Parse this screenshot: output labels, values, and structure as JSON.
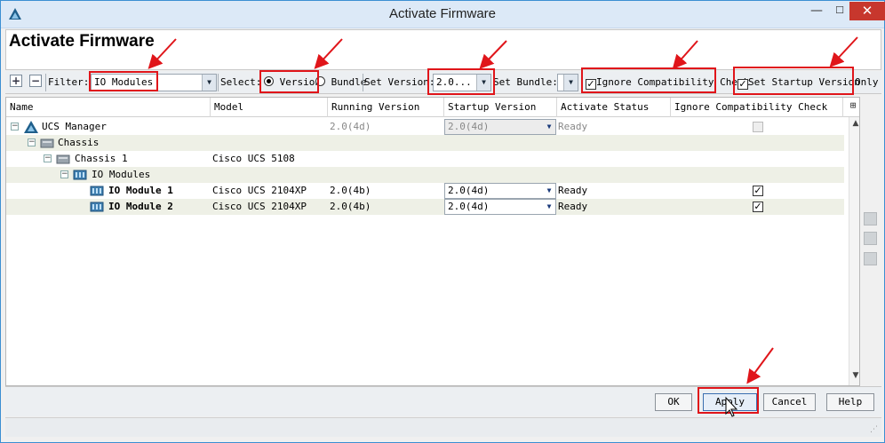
{
  "window": {
    "title": "Activate Firmware",
    "minimize": "—",
    "maximize": "☐",
    "close": "✕"
  },
  "header": {
    "title": "Activate Firmware"
  },
  "toolbar": {
    "expand": "+",
    "collapse": "−",
    "filter_label": "Filter:",
    "filter_value": "IO Modules",
    "select_label": "Select:",
    "version_radio": "Version",
    "bundle_radio": "Bundle",
    "set_version_label": "Set Version:",
    "set_version_value": "2.0...",
    "set_bundle_label": "Set Bundle:",
    "set_bundle_value": "",
    "ignore_check_label": "Ignore Compatibility Check",
    "startup_check_label": "Set Startup Version",
    "only_label": "Only"
  },
  "table": {
    "columns": [
      "Name",
      "Model",
      "Running Version",
      "Startup Version",
      "Activate Status",
      "Ignore Compatibility Check"
    ],
    "rows": [
      {
        "name": "UCS Manager",
        "model": "",
        "running": "2.0(4d)",
        "startup": "2.0(4d)",
        "status": "Ready",
        "ignore": false,
        "disabled": true
      },
      {
        "name": "Chassis",
        "model": "",
        "running": "",
        "startup": "",
        "status": "",
        "ignore": null
      },
      {
        "name": "Chassis 1",
        "model": "Cisco UCS 5108",
        "running": "",
        "startup": "",
        "status": "",
        "ignore": null
      },
      {
        "name": "IO Modules",
        "model": "",
        "running": "",
        "startup": "",
        "status": "",
        "ignore": null
      },
      {
        "name": "IO Module 1",
        "model": "Cisco UCS 2104XP",
        "running": "2.0(4b)",
        "startup": "2.0(4d)",
        "status": "Ready",
        "ignore": true
      },
      {
        "name": "IO Module 2",
        "model": "Cisco UCS 2104XP",
        "running": "2.0(4b)",
        "startup": "2.0(4d)",
        "status": "Ready",
        "ignore": true
      }
    ]
  },
  "buttons": {
    "ok": "OK",
    "apply": "Apply",
    "cancel": "Cancel",
    "help": "Help"
  },
  "icons": {
    "app": "ucs-triangle-icon",
    "column_chooser": "column-chooser-icon",
    "side": [
      "side-add-icon",
      "side-delete-icon",
      "side-copy-icon"
    ]
  },
  "colors": {
    "annotation_red": "#e0151a",
    "close_red": "#c7372d",
    "row_alt": "#eef0e6"
  }
}
